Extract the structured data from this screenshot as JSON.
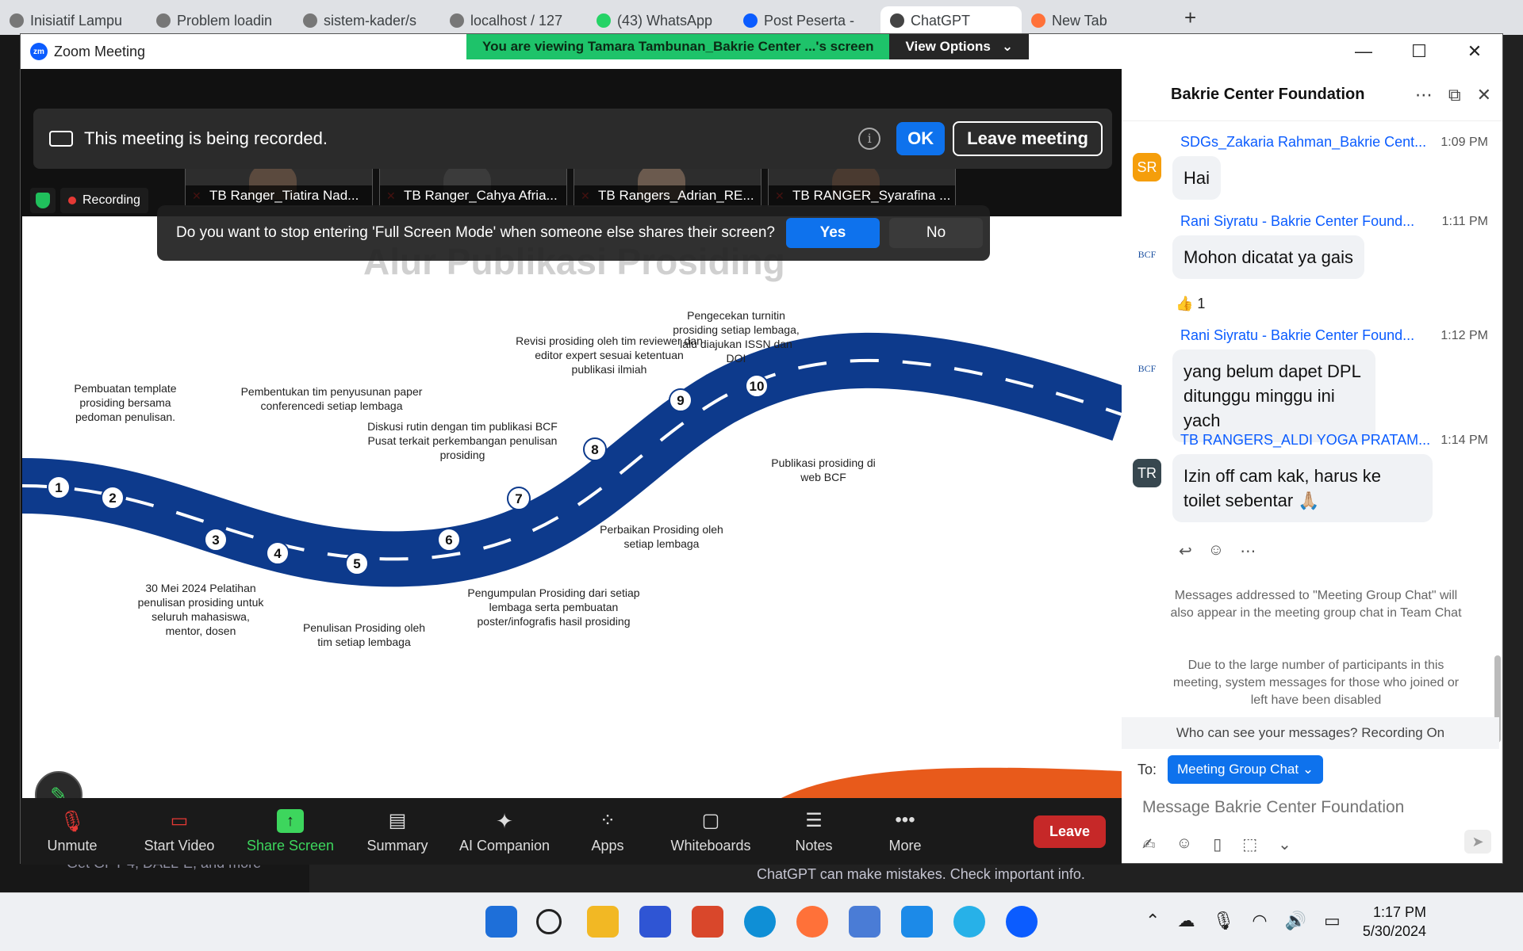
{
  "browser": {
    "tabs": [
      {
        "label": "Inisiatif Lampu"
      },
      {
        "label": "Problem loadin"
      },
      {
        "label": "sistem-kader/s"
      },
      {
        "label": "localhost / 127"
      },
      {
        "label": "(43) WhatsApp"
      },
      {
        "label": "Post Peserta -"
      },
      {
        "label": "ChatGPT",
        "active": true
      },
      {
        "label": "New Tab"
      }
    ],
    "new_tab": "+",
    "gpt_hint": "Get GPT-4, DALL·E, and more",
    "gpt_disclaimer": "ChatGPT can make mistakes. Check important info."
  },
  "zoom": {
    "title": "Zoom Meeting",
    "logo": "zm",
    "viewing": "You are viewing Tamara Tambunan_Bakrie Center ...'s screen",
    "view_options": "View Options",
    "win_min": "—",
    "win_max": "☐",
    "win_close": "✕",
    "recording_banner": {
      "text": "This meeting is being recorded.",
      "info": "i",
      "ok": "OK",
      "leave_meeting": "Leave meeting"
    },
    "participants": [
      {
        "name": "TB Ranger_Tiatira Nad..."
      },
      {
        "name": "TB Ranger_Cahya Afria..."
      },
      {
        "name": "TB Rangers_Adrian_RE..."
      },
      {
        "name": "TB RANGER_Syarafina ..."
      }
    ],
    "recording_badge": "Recording",
    "fullscreen_prompt": {
      "text": "Do you want to stop entering 'Full Screen Mode' when someone else shares their screen?",
      "yes": "Yes",
      "no": "No"
    },
    "slide": {
      "title": "Alur Publikasi Prosiding",
      "steps": [
        {
          "n": "1",
          "label": "Pembuatan template prosiding bersama pedoman penulisan."
        },
        {
          "n": "2",
          "label": "30 Mei 2024 Pelatihan penulisan prosiding untuk seluruh mahasiswa, mentor, dosen"
        },
        {
          "n": "3",
          "label": "Pembentukan tim penyusunan paper conferencedi setiap lembaga"
        },
        {
          "n": "4",
          "label": "Penulisan Prosiding oleh tim setiap lembaga"
        },
        {
          "n": "5",
          "label": "Diskusi rutin dengan tim publikasi BCF Pusat terkait perkembangan penulisan prosiding"
        },
        {
          "n": "6",
          "label": "Pengumpulan Prosiding dari setiap lembaga serta pembuatan poster/infografis hasil prosiding"
        },
        {
          "n": "7",
          "label": "Revisi prosiding oleh tim reviewer dan editor expert sesuai ketentuan publikasi ilmiah"
        },
        {
          "n": "8",
          "label": "Perbaikan Prosiding oleh setiap lembaga"
        },
        {
          "n": "9",
          "label": "Pengecekan turnitin prosiding setiap lembaga, lalu diajukan ISSN dan DOI"
        },
        {
          "n": "10",
          "label": "Publikasi prosiding di web BCF"
        }
      ]
    },
    "toolbar": [
      {
        "id": "unmute",
        "label": "Unmute",
        "icon": "mic-muted-icon"
      },
      {
        "id": "start-video",
        "label": "Start Video",
        "icon": "video-off-icon"
      },
      {
        "id": "share-screen",
        "label": "Share Screen",
        "icon": "share-screen-icon"
      },
      {
        "id": "summary",
        "label": "Summary",
        "icon": "summary-icon"
      },
      {
        "id": "ai-companion",
        "label": "AI Companion",
        "icon": "sparkle-icon"
      },
      {
        "id": "apps",
        "label": "Apps",
        "icon": "apps-icon"
      },
      {
        "id": "whiteboards",
        "label": "Whiteboards",
        "icon": "whiteboard-icon"
      },
      {
        "id": "notes",
        "label": "Notes",
        "icon": "notes-icon"
      },
      {
        "id": "more",
        "label": "More",
        "icon": "more-icon"
      }
    ],
    "leave": "Leave"
  },
  "chat": {
    "title": "Bakrie Center Foundation",
    "messages": [
      {
        "initials": "SR",
        "color": "#f59e0b",
        "sender": "SDGs_Zakaria Rahman_Bakrie Cent...",
        "time": "1:09 PM",
        "text": "Hai"
      },
      {
        "initials": "BCF",
        "color": "#ffffff",
        "sender": "Rani Siyratu - Bakrie Center Found...",
        "time": "1:11 PM",
        "text": "Mohon dicatat ya gais"
      },
      {
        "initials": "BCF",
        "color": "#ffffff",
        "sender": "Rani Siyratu - Bakrie Center Found...",
        "time": "1:12 PM",
        "text": "yang belum dapet DPL ditunggu minggu ini yach"
      },
      {
        "initials": "TR",
        "color": "#37474f",
        "sender": "TB RANGERS_ALDI YOGA PRATAM...",
        "time": "1:14 PM",
        "text": "Izin off cam kak, harus ke toilet sebentar 🙏🏼"
      }
    ],
    "reaction": "👍 1",
    "note1": "Messages addressed to \"Meeting Group Chat\" will also appear in the meeting group chat in Team Chat",
    "note2": "Due to the large number of participants in this meeting, system messages for those who joined or left have been disabled",
    "who_can_see": "Who can see your messages? Recording On",
    "to_label": "To:",
    "to_value": "Meeting Group Chat",
    "placeholder": "Message Bakrie Center Foundation"
  },
  "taskbar": {
    "time": "1:17 PM",
    "date": "5/30/2024"
  }
}
